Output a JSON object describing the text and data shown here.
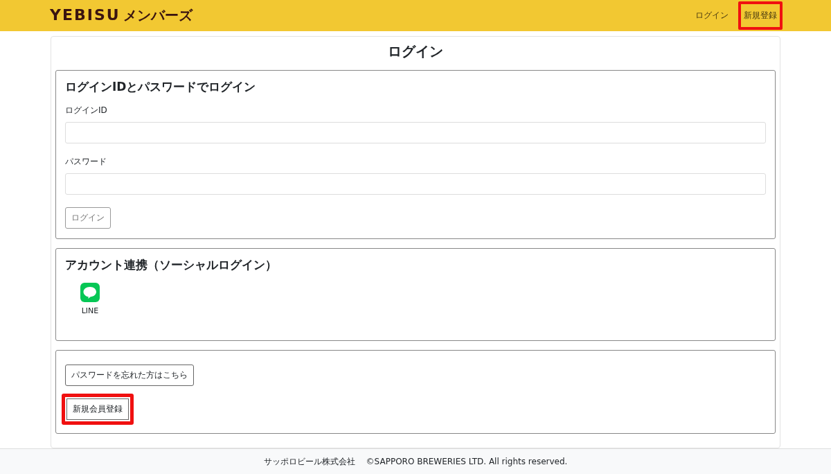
{
  "header": {
    "logo_latin": "YEBISU",
    "logo_kana": "メンバーズ",
    "nav": [
      {
        "label": "ログイン",
        "highlighted": false
      },
      {
        "label": "新規登録",
        "highlighted": true
      }
    ]
  },
  "page_title": "ログイン",
  "login_section": {
    "heading": "ログインIDとパスワードでログイン",
    "fields": [
      {
        "label": "ログインID"
      },
      {
        "label": "パスワード"
      }
    ],
    "submit": {
      "label": "ログイン",
      "disabled": true
    }
  },
  "social_section": {
    "heading": "アカウント連携（ソーシャルログイン）",
    "providers": [
      {
        "label": "LINE"
      }
    ]
  },
  "links_section": {
    "buttons": [
      {
        "label": "パスワードを忘れた方はこちら",
        "highlighted": false
      },
      {
        "label": "新規会員登録",
        "highlighted": true
      }
    ]
  },
  "footer": {
    "company": "サッポロビール株式会社",
    "copyright": "©SAPPORO BREWERIES LTD. All rights reserved."
  }
}
